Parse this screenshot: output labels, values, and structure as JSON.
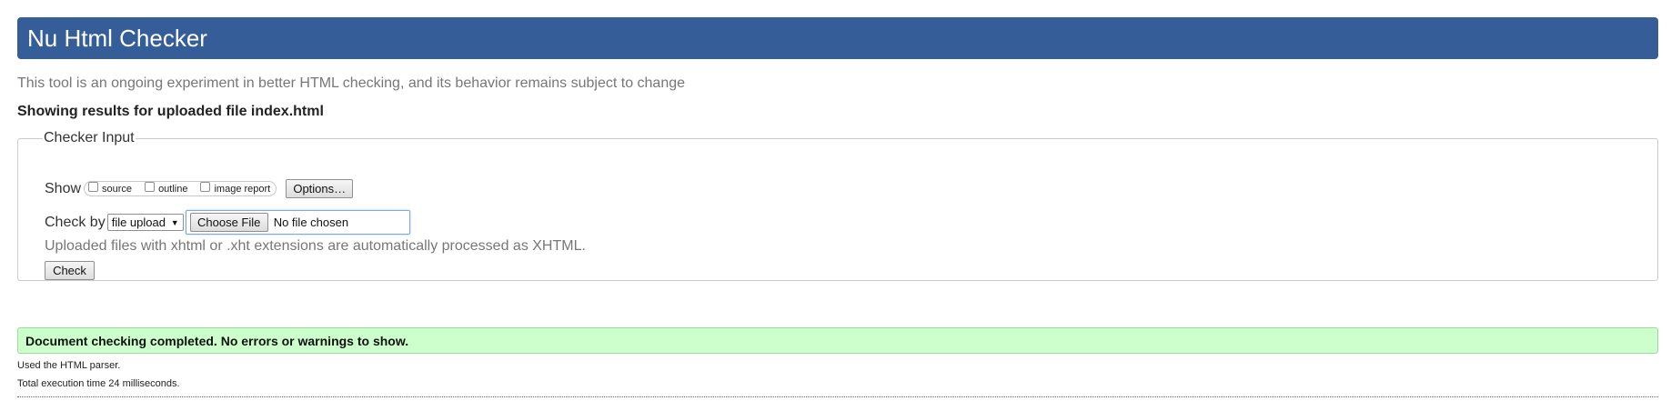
{
  "header": {
    "title": "Nu Html Checker"
  },
  "intro_text": "This tool is an ongoing experiment in better HTML checking, and its behavior remains subject to change",
  "results_heading": "Showing results for uploaded file index.html",
  "checker_input": {
    "legend": "Checker Input",
    "show_label": "Show",
    "show_options": [
      {
        "label": "source",
        "checked": false
      },
      {
        "label": "outline",
        "checked": false
      },
      {
        "label": "image report",
        "checked": false
      }
    ],
    "options_button": "Options…",
    "check_by_label": "Check by",
    "check_by_selected": "file upload",
    "choose_file_button": "Choose File",
    "file_status": "No file chosen",
    "note": "Uploaded files with xhtml or .xht extensions are automatically processed as XHTML.",
    "check_button": "Check"
  },
  "result": {
    "success_message": "Document checking completed. No errors or warnings to show.",
    "parser_info": "Used the HTML parser.",
    "execution_time": "Total execution time 24 milliseconds."
  },
  "colors": {
    "header_bg": "#355e99",
    "success_bg": "#ccffcc",
    "muted_text": "#777777"
  }
}
